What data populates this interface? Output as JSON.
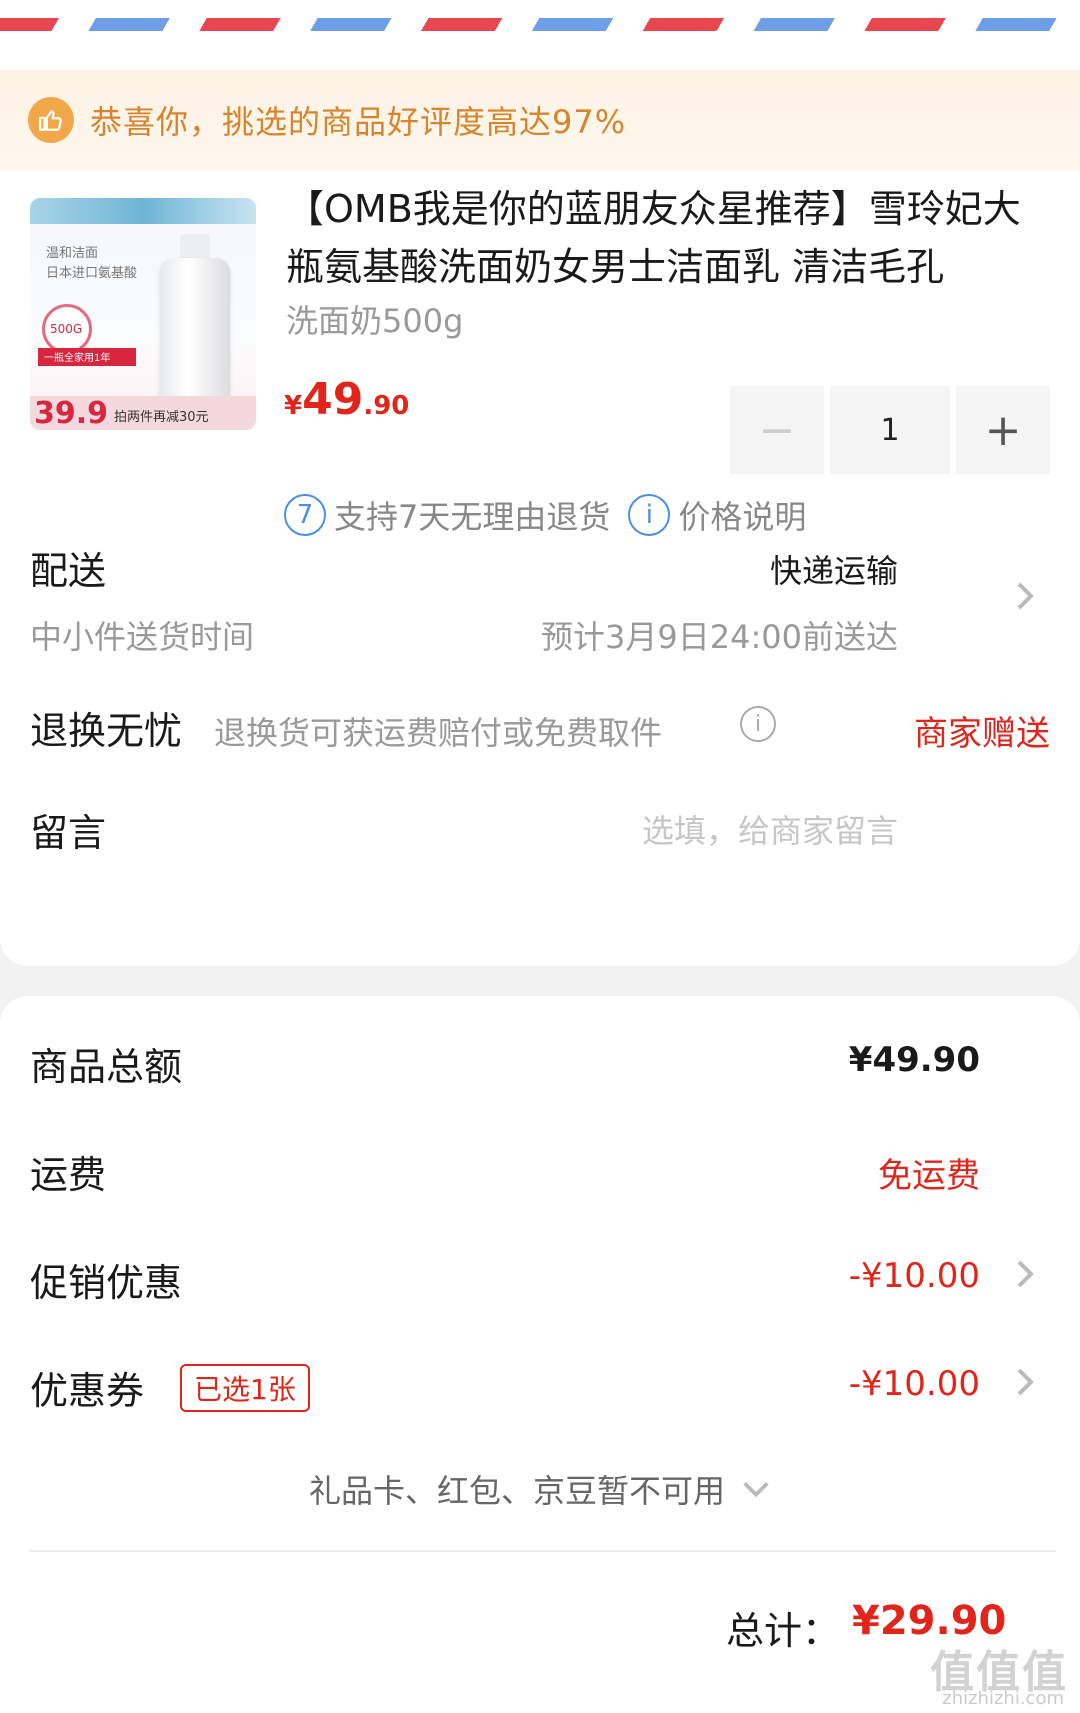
{
  "banner": {
    "text": "恭喜你，挑选的商品好评度高达97%"
  },
  "product": {
    "title": "【OMB我是你的蓝朋友众星推荐】雪玲妃大瓶氨基酸洗面奶女男士洁面乳 清洁毛孔",
    "spec": "洗面奶500g",
    "price_yen": "¥",
    "price_int": "49",
    "price_dec": ".90",
    "quantity": "1",
    "image_texts": {
      "line1": "温和洁面",
      "line2": "日本进口氨基酸",
      "size": "500G",
      "ribbon": "一瓶全家用1年",
      "promo_price": "39.9",
      "promo": "拍两件再减30元"
    }
  },
  "services": {
    "return_badge": "7",
    "return_text": "支持7天无理由退货",
    "info_badge": "i",
    "price_note": "价格说明"
  },
  "delivery": {
    "label": "配送",
    "method": "快递运输",
    "sub_label": "中小件送货时间",
    "eta": "预计3月9日24:00前送达"
  },
  "returns": {
    "label": "退换无忧",
    "desc": "退换货可获运费赔付或免费取件",
    "value": "商家赠送"
  },
  "message": {
    "label": "留言",
    "placeholder": "选填，给商家留言"
  },
  "summary": {
    "goods_label": "商品总额",
    "goods_value": "¥49.90",
    "shipping_label": "运费",
    "shipping_value": "免运费",
    "promo_label": "促销优惠",
    "promo_value": "-¥10.00",
    "coupon_label": "优惠券",
    "coupon_tag": "已选1张",
    "coupon_value": "-¥10.00",
    "unavailable": "礼品卡、红包、京豆暂不可用",
    "total_label": "总计：",
    "total_value": "¥29.90"
  },
  "watermark": {
    "main": "值值值",
    "site": "zhizhizhi.com"
  },
  "colors": {
    "accent_red": "#e1251b",
    "banner_orange": "#d8842c",
    "info_blue": "#4a8fe0"
  }
}
